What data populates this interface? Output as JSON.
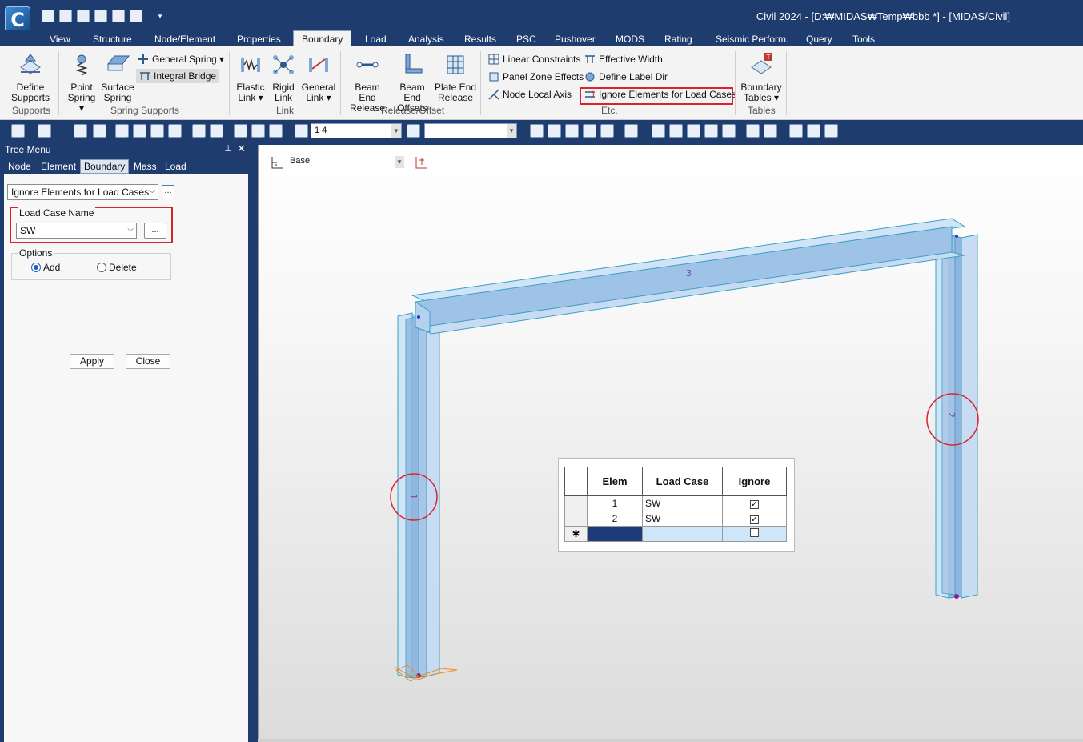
{
  "app": {
    "logo_letter": "C",
    "title": "Civil 2024 - [D:₩MIDAS₩Temp₩bbb *] - [MIDAS/Civil]"
  },
  "menu": {
    "tabs": [
      "View",
      "Structure",
      "Node/Element",
      "Properties",
      "Boundary",
      "Load",
      "Analysis",
      "Results",
      "PSC",
      "Pushover",
      "MODS",
      "Rating",
      "Seismic Perform.",
      "Query",
      "Tools"
    ],
    "active": "Boundary"
  },
  "ribbon": {
    "supports": {
      "define_l1": "Define",
      "define_l2": "Supports",
      "group": "Supports"
    },
    "spring": {
      "point_l1": "Point",
      "point_l2": "Spring ▾",
      "surface_l1": "Surface",
      "surface_l2": "Spring",
      "general_spring": "General Spring ▾",
      "integral_bridge": "Integral Bridge",
      "group": "Spring Supports"
    },
    "link": {
      "elastic_l1": "Elastic",
      "elastic_l2": "Link ▾",
      "rigid_l1": "Rigid",
      "rigid_l2": "Link",
      "general_l1": "General",
      "general_l2": "Link ▾",
      "group": "Link"
    },
    "release": {
      "beam_end_l1": "Beam End",
      "beam_end_l2": "Release",
      "offsets_l1": "Beam End",
      "offsets_l2": "Offsets",
      "plate_l1": "Plate End",
      "plate_l2": "Release",
      "group": "Release/Offset"
    },
    "etc": {
      "linear_constraints": "Linear Constraints",
      "effective_width": "Effective Width",
      "panel_zone": "Panel Zone Effects",
      "label_dir": "Define Label Dir",
      "node_local_axis": "Node Local Axis",
      "ignore_elements": "Ignore Elements for Load Cases",
      "group": "Etc."
    },
    "tables": {
      "boundary_l1": "Boundary",
      "boundary_l2": "Tables ▾",
      "group": "Tables"
    }
  },
  "toolbar": {
    "select_value": "1 4",
    "second_value": ""
  },
  "tree": {
    "title": "Tree Menu",
    "pin": "&#x1F4CC;",
    "close": "✕",
    "tabs": [
      "Node",
      "Element",
      "Boundary",
      "Mass",
      "Load"
    ],
    "active_tab": "Boundary",
    "function": "Ignore Elements for Load Cases",
    "load_case_label": "Load Case Name",
    "load_case_value": "SW",
    "more_button": "...",
    "options_label": "Options",
    "option_add": "Add",
    "option_delete": "Delete",
    "selected_option": "Add",
    "apply": "Apply",
    "close_btn": "Close"
  },
  "view": {
    "plane": "Base",
    "element_labels": [
      "1",
      "2",
      "3"
    ]
  },
  "ignore_table": {
    "headers": [
      "Elem",
      "Load Case",
      "Ignore"
    ],
    "rows": [
      {
        "elem": "1",
        "load_case": "SW",
        "ignore": true
      },
      {
        "elem": "2",
        "load_case": "SW",
        "ignore": true
      }
    ],
    "new_row_marker": "✱"
  },
  "colors": {
    "frame": "#1f3c6e",
    "highlight": "#d9242f",
    "member_fill": "#9fc3e6"
  }
}
